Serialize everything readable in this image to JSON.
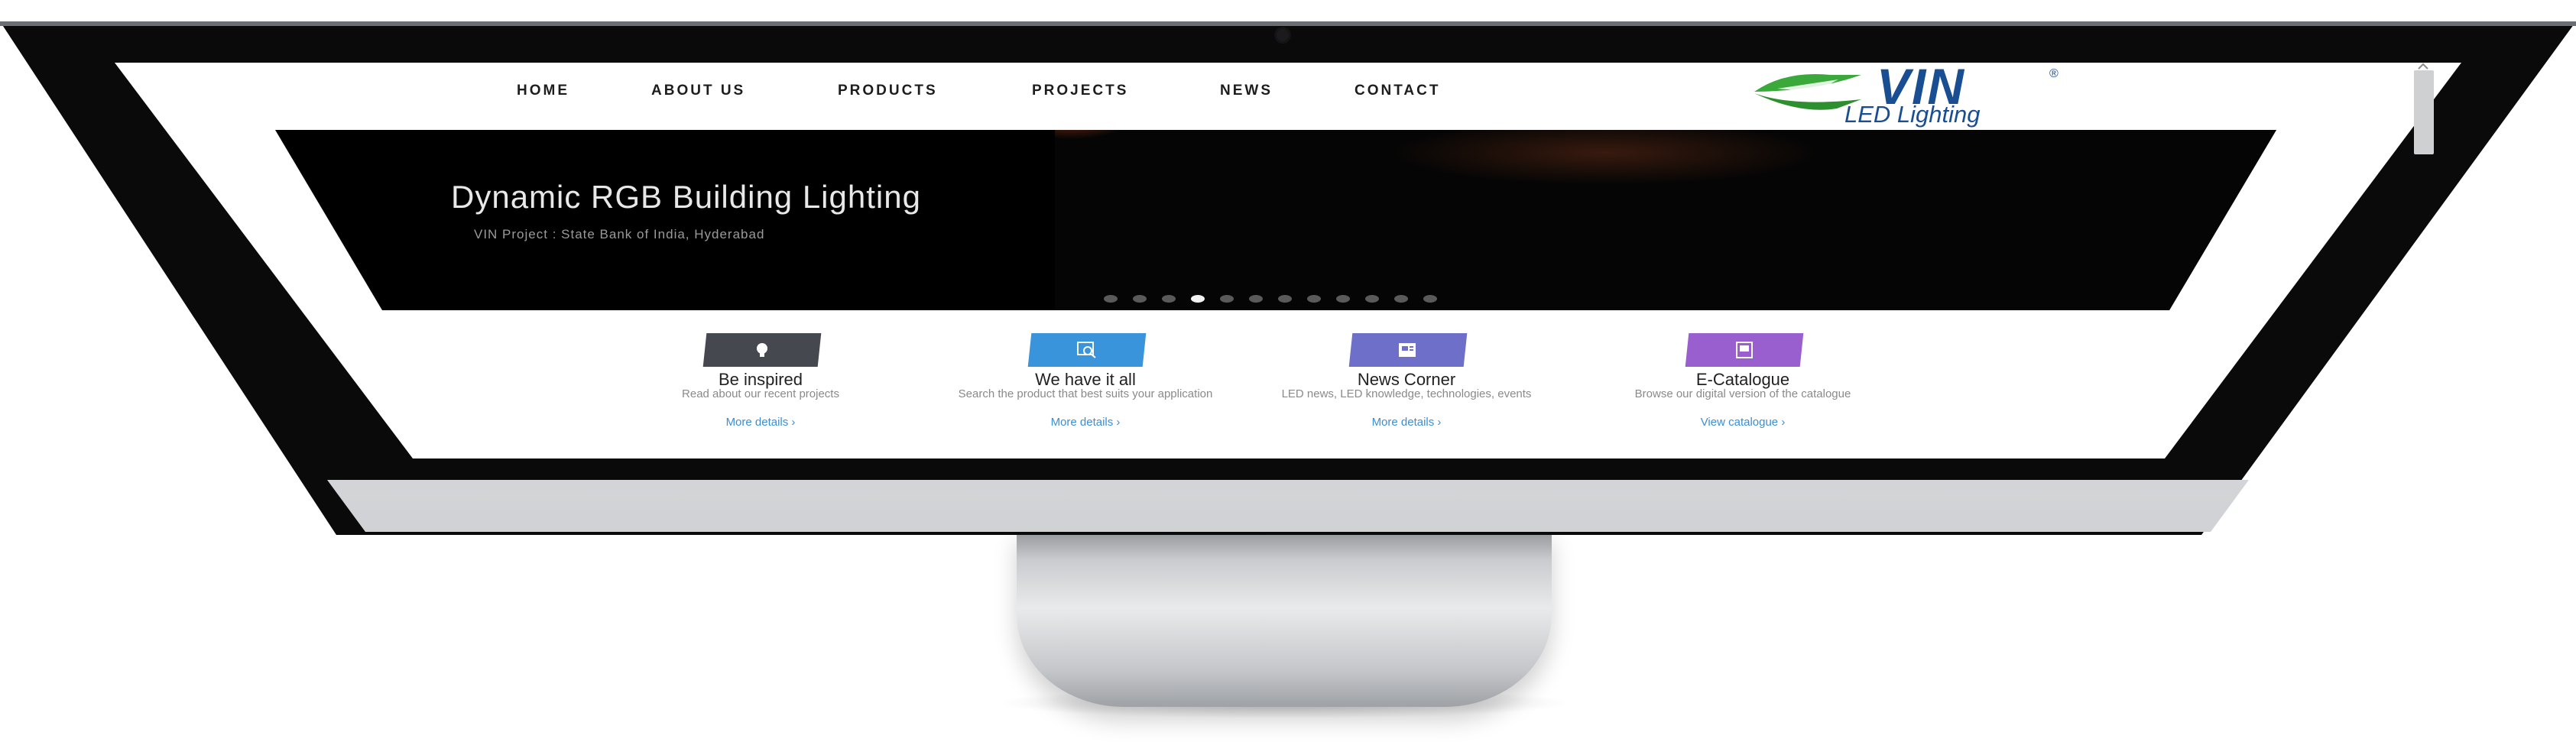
{
  "nav": {
    "items": [
      "HOME",
      "ABOUT US",
      "PRODUCTS",
      "PROJECTS",
      "NEWS",
      "CONTACT"
    ]
  },
  "logo": {
    "brand": "VIN",
    "registered": "®",
    "tagline": "LED Lighting"
  },
  "hero": {
    "title": "Dynamic RGB Building Lighting",
    "caption": "VIN Project : State Bank of India, Hyderabad",
    "slide_count": 12,
    "active_slide": 4
  },
  "features": [
    {
      "title": "Be inspired",
      "description": "Read about our recent projects",
      "link": "More details ›",
      "icon": "lightbulb-icon",
      "color": "#45494f"
    },
    {
      "title": "We have it all",
      "description": "Search the product that best suits your application",
      "link": "More details ›",
      "icon": "search-product-icon",
      "color": "#3a94dc"
    },
    {
      "title": "News Corner",
      "description": "LED news, LED knowledge, technologies, events",
      "link": "More details ›",
      "icon": "news-icon",
      "color": "#6d6fc8"
    },
    {
      "title": "E-Catalogue",
      "description": "Browse our digital version of the catalogue",
      "link": "View catalogue ›",
      "icon": "catalogue-icon",
      "color": "#9a5fcf"
    }
  ],
  "colors": {
    "brand_blue": "#1a4e93",
    "brand_green": "#3aa83a",
    "link": "#3c8ed4"
  }
}
